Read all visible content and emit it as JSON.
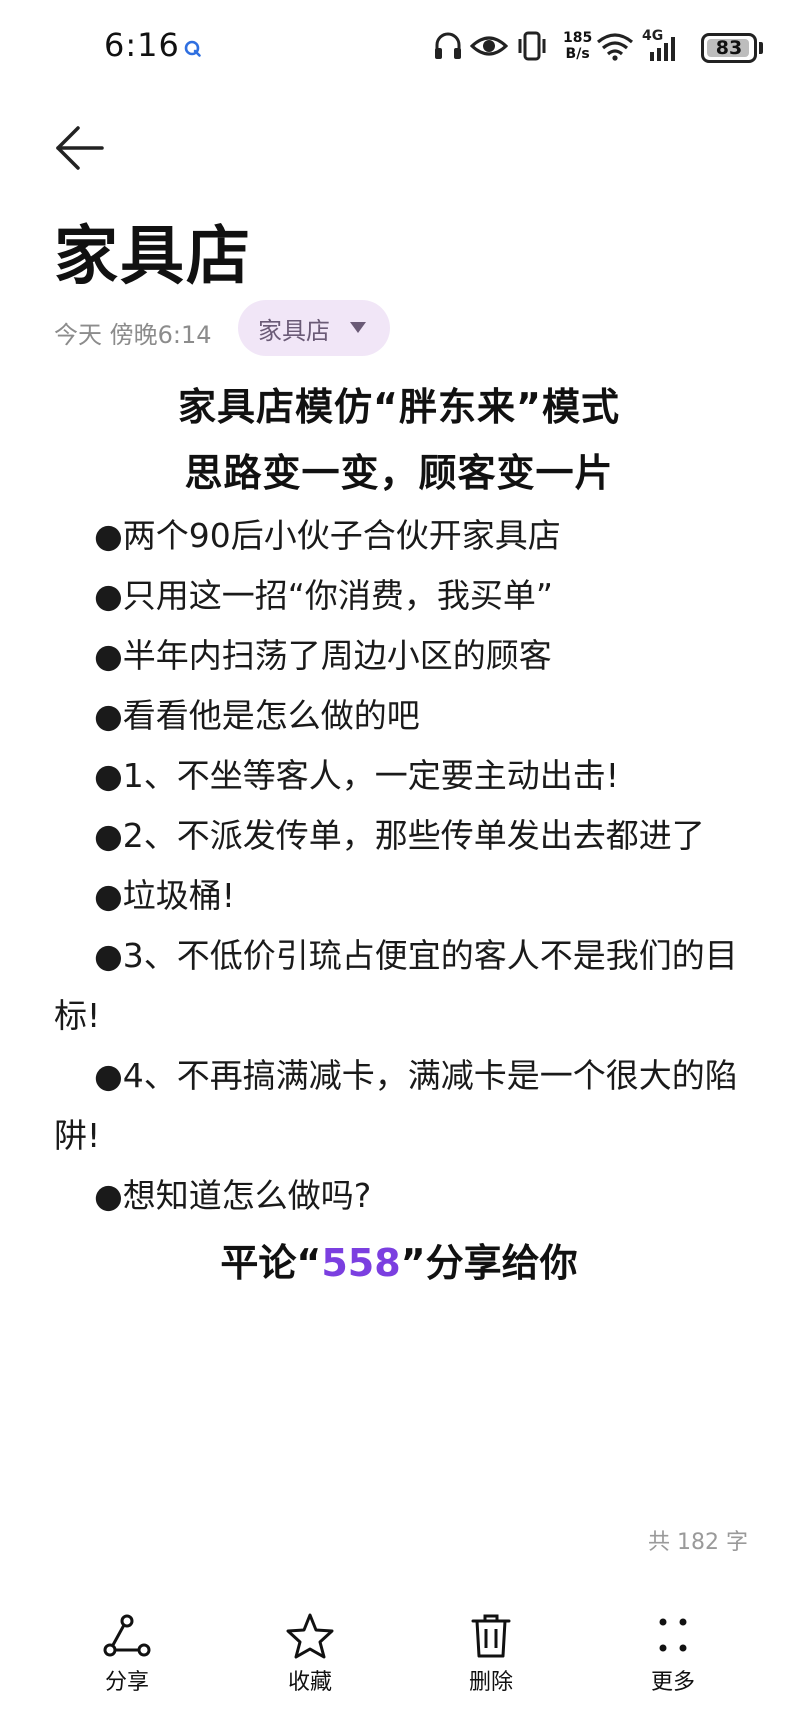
{
  "status_bar": {
    "time": "6:16",
    "net_speed_value": "185",
    "net_speed_unit": "B/s",
    "signal_label": "4G",
    "battery_level": "83",
    "icons": [
      "q-notification-icon",
      "headphones-icon",
      "eye-comfort-icon",
      "vibrate-icon",
      "wifi-icon",
      "signal-4g-icon",
      "battery-icon"
    ]
  },
  "header": {
    "back_icon": "back-arrow-icon",
    "title": "家具店",
    "timestamp": "今天 傍晚6:14",
    "folder": "家具店"
  },
  "note": {
    "heading_lines": [
      "家具店模仿“胖东来”模式",
      "思路变一变，顾客变一片"
    ],
    "paragraphs": [
      "●两个90后小伙子合伙开家具店",
      "●只用这一招“你消费，我买单”",
      "●半年内扫荡了周边小区的顾客",
      "●看看他是怎么做的吧",
      "●1、不坐等客人，一定要主动出击!",
      "●2、不派发传单，那些传单发出去都进了",
      "●垃圾桶!",
      "●3、不低价引琉占便宜的客人不是我们的目标!",
      "●4、不再搞满减卡，满减卡是一个很大的陷阱!",
      "●想知道怎么做吗?"
    ],
    "closing_prefix": "平论“",
    "closing_highlight": "558",
    "closing_suffix": "”分享给你",
    "highlight_color": "#7b3fe0"
  },
  "word_count": "共 182 字",
  "bottom_bar": {
    "items": [
      {
        "label": "分享",
        "icon": "share-icon"
      },
      {
        "label": "收藏",
        "icon": "star-icon"
      },
      {
        "label": "删除",
        "icon": "trash-icon"
      },
      {
        "label": "更多",
        "icon": "more-icon"
      }
    ]
  }
}
